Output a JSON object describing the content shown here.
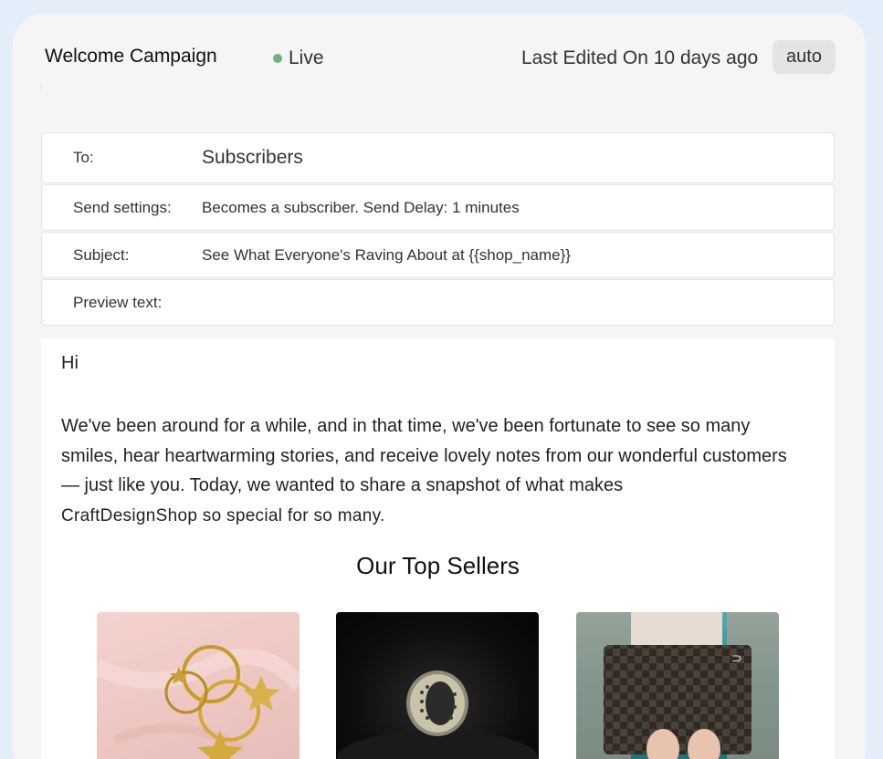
{
  "header": {
    "title": "Welcome Campaign",
    "status": "Live",
    "last_edited": "Last Edited On 10 days ago",
    "badge": "auto"
  },
  "fields": {
    "to_label": "To:",
    "to_value": "Subscribers",
    "send_label": "Send settings:",
    "send_value": "Becomes a subscriber. Send Delay: 1 minutes",
    "subject_label": "Subject:",
    "subject_value": "See What Everyone's Raving About at {{shop_name}}",
    "preview_label": "Preview text:",
    "preview_value": ""
  },
  "email": {
    "greeting": "Hi",
    "paragraph": "We've been around for a while, and in that time, we've been fortunate to see so many smiles, hear heartwarming stories, and receive lovely notes from our wonderful customers — just like you. Today, we wanted to share a snapshot of what makes",
    "shop_name": "CraftDesignShop",
    "paragraph_end": " so special for so many.",
    "section_title": "Our Top Sellers"
  },
  "colors": {
    "page_bg": "#e4eefb",
    "card_bg": "#f5f5f5",
    "live_dot": "#6fb07a",
    "badge_bg": "#e4e4e4"
  },
  "icons": {
    "status": "live-dot-icon"
  }
}
